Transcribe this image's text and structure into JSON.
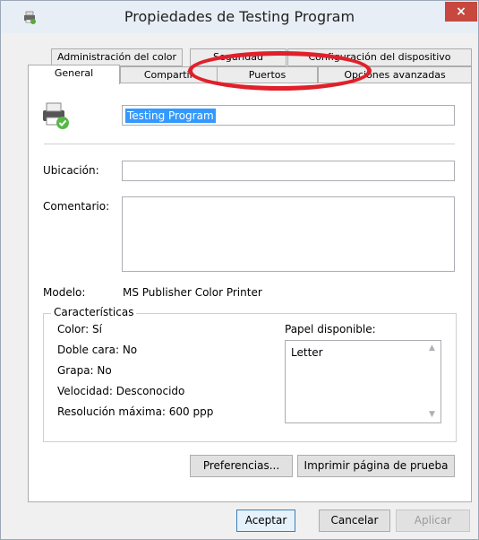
{
  "window": {
    "title": "Propiedades de Testing Program",
    "close_label": "×"
  },
  "tabs": {
    "back_row": [
      "Administración del color",
      "Seguridad",
      "Configuración del dispositivo"
    ],
    "front_row": [
      "General",
      "Compartir",
      "Puertos",
      "Opciones avanzadas"
    ],
    "active": "General"
  },
  "general": {
    "printer_name": "Testing Program",
    "location_label": "Ubicación:",
    "location_value": "",
    "comment_label": "Comentario:",
    "comment_value": "",
    "model_label": "Modelo:",
    "model_value": "MS Publisher Color Printer",
    "features": {
      "title": "Características",
      "color": "Color: Sí",
      "duplex": "Doble cara: No",
      "staple": "Grapa: No",
      "speed": "Velocidad: Desconocido",
      "max_resolution": "Resolución máxima: 600 ppp",
      "paper_label": "Papel disponible:",
      "paper_options": [
        "Letter"
      ]
    },
    "preferences_button": "Preferencias...",
    "test_page_button": "Imprimir página de prueba"
  },
  "footer": {
    "ok": "Aceptar",
    "cancel": "Cancelar",
    "apply": "Aplicar"
  },
  "colors": {
    "selection": "#3399ff",
    "annotation_circle": "#e0202a",
    "close_button": "#c7483e"
  }
}
